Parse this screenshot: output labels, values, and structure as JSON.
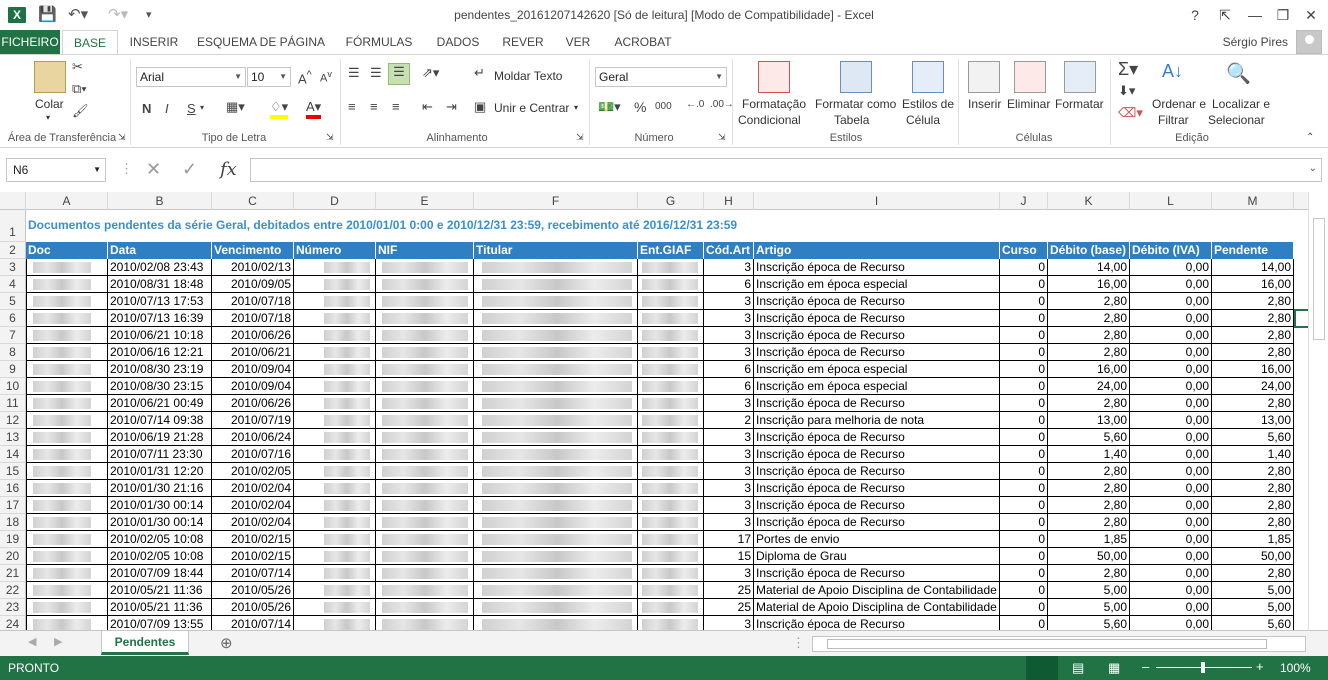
{
  "window": {
    "title": "pendentes_20161207142620  [Só de leitura]  [Modo de Compatibilidade] - Excel",
    "help": "?",
    "minimize": "—",
    "restore": "❐",
    "close": "✕"
  },
  "ribbon_tabs": [
    "FICHEIRO",
    "BASE",
    "INSERIR",
    "ESQUEMA DE PÁGINA",
    "FÓRMULAS",
    "DADOS",
    "REVER",
    "VER",
    "ACROBAT"
  ],
  "user": "Sérgio Pires",
  "ribbon": {
    "clipboard": {
      "paste": "Colar",
      "label": "Área de Transferência"
    },
    "font": {
      "name": "Arial",
      "size": "10",
      "bold": "N",
      "italic": "I",
      "underline": "S",
      "label": "Tipo de Letra"
    },
    "alignment": {
      "wrap": "Moldar Texto",
      "merge": "Unir e Centrar",
      "label": "Alinhamento"
    },
    "number": {
      "format": "Geral",
      "percent": "%",
      "thousands": "000",
      "label": "Número"
    },
    "styles": {
      "conditional": [
        "Formatação",
        "Condicional"
      ],
      "table": [
        "Formatar como",
        "Tabela"
      ],
      "cell_styles": [
        "Estilos de",
        "Célula"
      ],
      "label": "Estilos"
    },
    "cells": {
      "insert": "Inserir",
      "delete": "Eliminar",
      "format": "Formatar",
      "label": "Células"
    },
    "editing": {
      "sort": [
        "Ordenar e",
        "Filtrar"
      ],
      "find": [
        "Localizar e",
        "Selecionar"
      ],
      "label": "Edição"
    }
  },
  "formula_bar": {
    "name_box": "N6",
    "fx": "fx",
    "formula": ""
  },
  "columns": [
    "A",
    "B",
    "C",
    "D",
    "E",
    "F",
    "G",
    "H",
    "I",
    "J",
    "K",
    "L",
    "M"
  ],
  "rows": [
    "1",
    "2",
    "3",
    "4",
    "5",
    "6",
    "7",
    "8",
    "9",
    "10",
    "11",
    "12",
    "13",
    "14",
    "15",
    "16",
    "17",
    "18",
    "19",
    "20",
    "21",
    "22",
    "23",
    "24"
  ],
  "report_title": "Documentos pendentes da série Geral, debitados entre 2010/01/01 0:00 e 2010/12/31 23:59, recebimento até 2016/12/31 23:59",
  "table_headers": [
    "Doc",
    "Data",
    "Vencimento",
    "Número",
    "NIF",
    "Titular",
    "Ent.GIAF",
    "Cód.Art",
    "Artigo",
    "Curso",
    "Débito (base)",
    "Débito (IVA)",
    "Pendente"
  ],
  "table_rows": [
    [
      "2010/02/08 23:43",
      "2010/02/13",
      "3",
      "Inscrição época de Recurso",
      "0",
      "14,00",
      "0,00",
      "14,00"
    ],
    [
      "2010/08/31 18:48",
      "2010/09/05",
      "6",
      "Inscrição em época especial",
      "0",
      "16,00",
      "0,00",
      "16,00"
    ],
    [
      "2010/07/13 17:53",
      "2010/07/18",
      "3",
      "Inscrição época de Recurso",
      "0",
      "2,80",
      "0,00",
      "2,80"
    ],
    [
      "2010/07/13 16:39",
      "2010/07/18",
      "3",
      "Inscrição época de Recurso",
      "0",
      "2,80",
      "0,00",
      "2,80"
    ],
    [
      "2010/06/21 10:18",
      "2010/06/26",
      "3",
      "Inscrição época de Recurso",
      "0",
      "2,80",
      "0,00",
      "2,80"
    ],
    [
      "2010/06/16 12:21",
      "2010/06/21",
      "3",
      "Inscrição época de Recurso",
      "0",
      "2,80",
      "0,00",
      "2,80"
    ],
    [
      "2010/08/30 23:19",
      "2010/09/04",
      "6",
      "Inscrição em época especial",
      "0",
      "16,00",
      "0,00",
      "16,00"
    ],
    [
      "2010/08/30 23:15",
      "2010/09/04",
      "6",
      "Inscrição em época especial",
      "0",
      "24,00",
      "0,00",
      "24,00"
    ],
    [
      "2010/06/21 00:49",
      "2010/06/26",
      "3",
      "Inscrição época de Recurso",
      "0",
      "2,80",
      "0,00",
      "2,80"
    ],
    [
      "2010/07/14 09:38",
      "2010/07/19",
      "2",
      "Inscrição para melhoria de nota",
      "0",
      "13,00",
      "0,00",
      "13,00"
    ],
    [
      "2010/06/19 21:28",
      "2010/06/24",
      "3",
      "Inscrição época de Recurso",
      "0",
      "5,60",
      "0,00",
      "5,60"
    ],
    [
      "2010/07/11 23:30",
      "2010/07/16",
      "3",
      "Inscrição época de Recurso",
      "0",
      "1,40",
      "0,00",
      "1,40"
    ],
    [
      "2010/01/31 12:20",
      "2010/02/05",
      "3",
      "Inscrição época de Recurso",
      "0",
      "2,80",
      "0,00",
      "2,80"
    ],
    [
      "2010/01/30 21:16",
      "2010/02/04",
      "3",
      "Inscrição época de Recurso",
      "0",
      "2,80",
      "0,00",
      "2,80"
    ],
    [
      "2010/01/30 00:14",
      "2010/02/04",
      "3",
      "Inscrição época de Recurso",
      "0",
      "2,80",
      "0,00",
      "2,80"
    ],
    [
      "2010/01/30 00:14",
      "2010/02/04",
      "3",
      "Inscrição época de Recurso",
      "0",
      "2,80",
      "0,00",
      "2,80"
    ],
    [
      "2010/02/05 10:08",
      "2010/02/15",
      "17",
      "Portes de envio",
      "0",
      "1,85",
      "0,00",
      "1,85"
    ],
    [
      "2010/02/05 10:08",
      "2010/02/15",
      "15",
      "Diploma de Grau",
      "0",
      "50,00",
      "0,00",
      "50,00"
    ],
    [
      "2010/07/09 18:44",
      "2010/07/14",
      "3",
      "Inscrição época de Recurso",
      "0",
      "2,80",
      "0,00",
      "2,80"
    ],
    [
      "2010/05/21 11:36",
      "2010/05/26",
      "25",
      "Material de Apoio Disciplina de Contabilidade",
      "0",
      "5,00",
      "0,00",
      "5,00"
    ],
    [
      "2010/05/21 11:36",
      "2010/05/26",
      "25",
      "Material de Apoio Disciplina de Contabilidade",
      "0",
      "5,00",
      "0,00",
      "5,00"
    ],
    [
      "2010/07/09 13:55",
      "2010/07/14",
      "3",
      "Inscrição época de Recurso",
      "0",
      "5,60",
      "0,00",
      "5,60"
    ]
  ],
  "sheet_tab": "Pendentes",
  "status": {
    "ready": "PRONTO",
    "zoom": "100%"
  },
  "colors": {
    "excel_green": "#217346",
    "header_blue": "#2f7fc2",
    "title_blue": "#3a8fd2"
  }
}
